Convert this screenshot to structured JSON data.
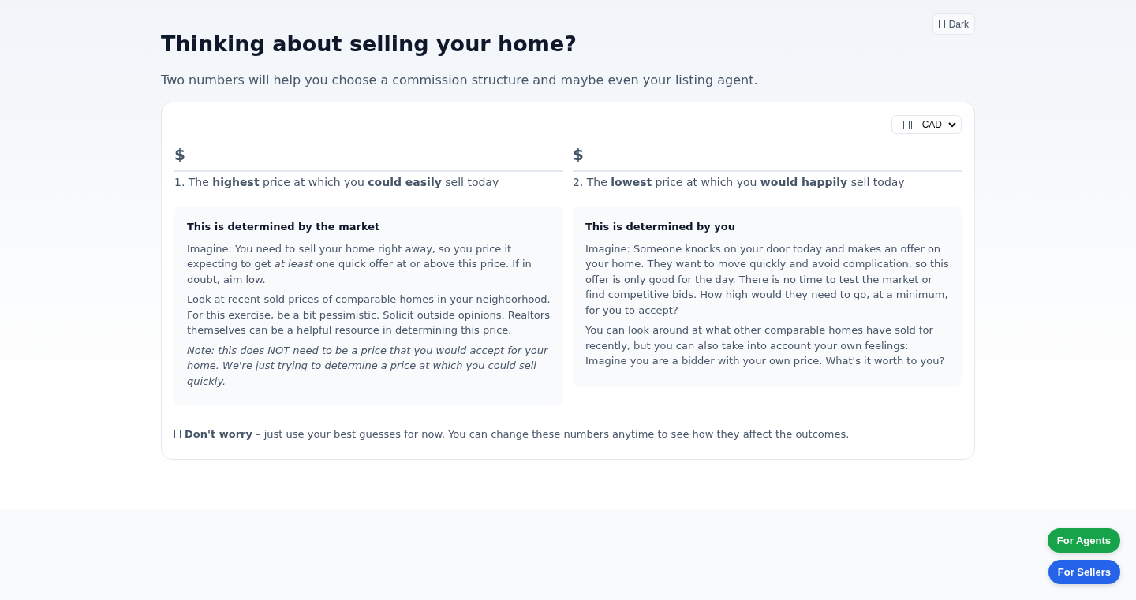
{
  "theme_button": {
    "label": "Dark"
  },
  "title": "Thinking about selling your home?",
  "subtitle": "Two numbers will help you choose a commission structure and maybe even your listing agent.",
  "currency": {
    "value": "CAD"
  },
  "prices": [
    {
      "symbol": "$",
      "label": "1. The **highest** price at which you **could easily** sell today",
      "heading": "This is determined by the market",
      "paragraphs": [
        "Imagine: You need to sell your home right away, so you price it expecting to get *at least* one quick offer at or above this price. If in doubt, aim low.",
        "Look at recent sold prices of comparable homes in your neighborhood. For this exercise, be a bit pessimistic. Solicit outside opinions. Realtors themselves can be a helpful resource in determining this price.",
        "*Note: this does NOT need to be a price that you would accept for your home. We're just trying to determine a price at which you could sell quickly.*"
      ]
    },
    {
      "symbol": "$",
      "label": "2. The **lowest** price at which you **would happily** sell today",
      "heading": "This is determined by you",
      "paragraphs": [
        "Imagine: Someone knocks on your door today and makes an offer on your home. They want to move quickly and avoid complication, so this offer is only good for the day. There is no time to test the market or find competitive bids. How high would they need to go, at a minimum, for you to accept?",
        "You can look around at what other comparable homes have sold for recently, but you can also take into account your own feelings: Imagine you are a bidder with your own price. What's it worth to you?"
      ]
    }
  ],
  "note": "**Don't worry** – just use your best guesses for now. You can change these numbers anytime to see how they affect the outcomes.",
  "floating_buttons": [
    {
      "label": "For Agents",
      "color": "#16a34a"
    },
    {
      "label": "For Sellers",
      "color": "#2563eb"
    }
  ]
}
